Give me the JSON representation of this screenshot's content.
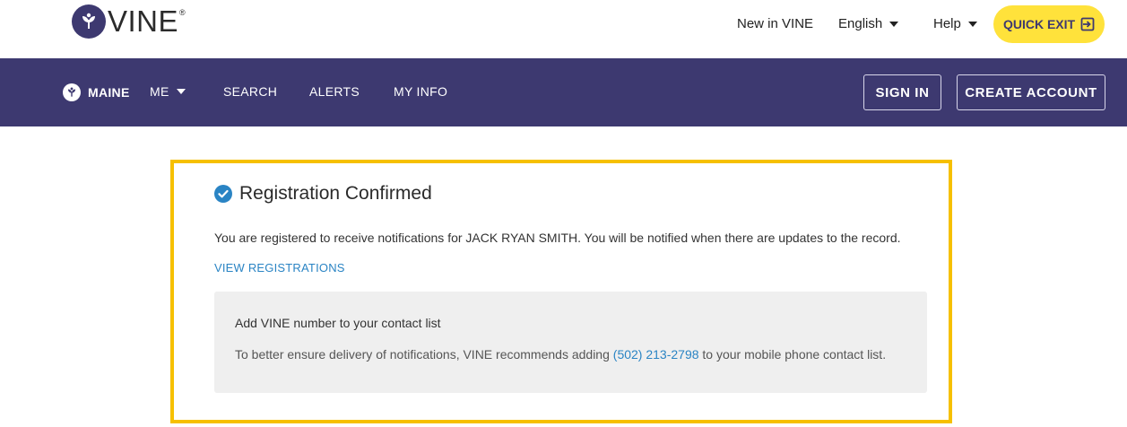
{
  "brand": {
    "name": "VINE",
    "reg_mark": "®"
  },
  "top": {
    "new_in_vine": "New in VINE",
    "language": "English",
    "help": "Help",
    "quick_exit": "QUICK EXIT"
  },
  "nav": {
    "state": "MAINE",
    "state_code": "ME",
    "items": [
      "SEARCH",
      "ALERTS",
      "MY INFO"
    ],
    "sign_in": "SIGN IN",
    "create_account": "CREATE ACCOUNT"
  },
  "confirmation": {
    "title": "Registration Confirmed",
    "message": "You are registered to receive notifications for JACK RYAN SMITH. You will be notified when there are updates to the record.",
    "view_link": "VIEW REGISTRATIONS",
    "panel": {
      "title": "Add VINE number to your contact list",
      "text_before": "To better ensure delivery of notifications, VINE recommends adding ",
      "phone": "(502) 213-2798",
      "text_after": " to your mobile phone contact list."
    }
  },
  "colors": {
    "nav_bg": "#3d3970",
    "quick_exit_bg": "#ffe23b",
    "highlight_border": "#f6c000",
    "link": "#2a84c4",
    "check": "#2a84c4"
  },
  "icons": {
    "logo": "vine-leaf-icon",
    "quick_exit": "exit-door-icon",
    "confirmed": "check-circle-icon",
    "dropdown": "caret-down-icon"
  }
}
